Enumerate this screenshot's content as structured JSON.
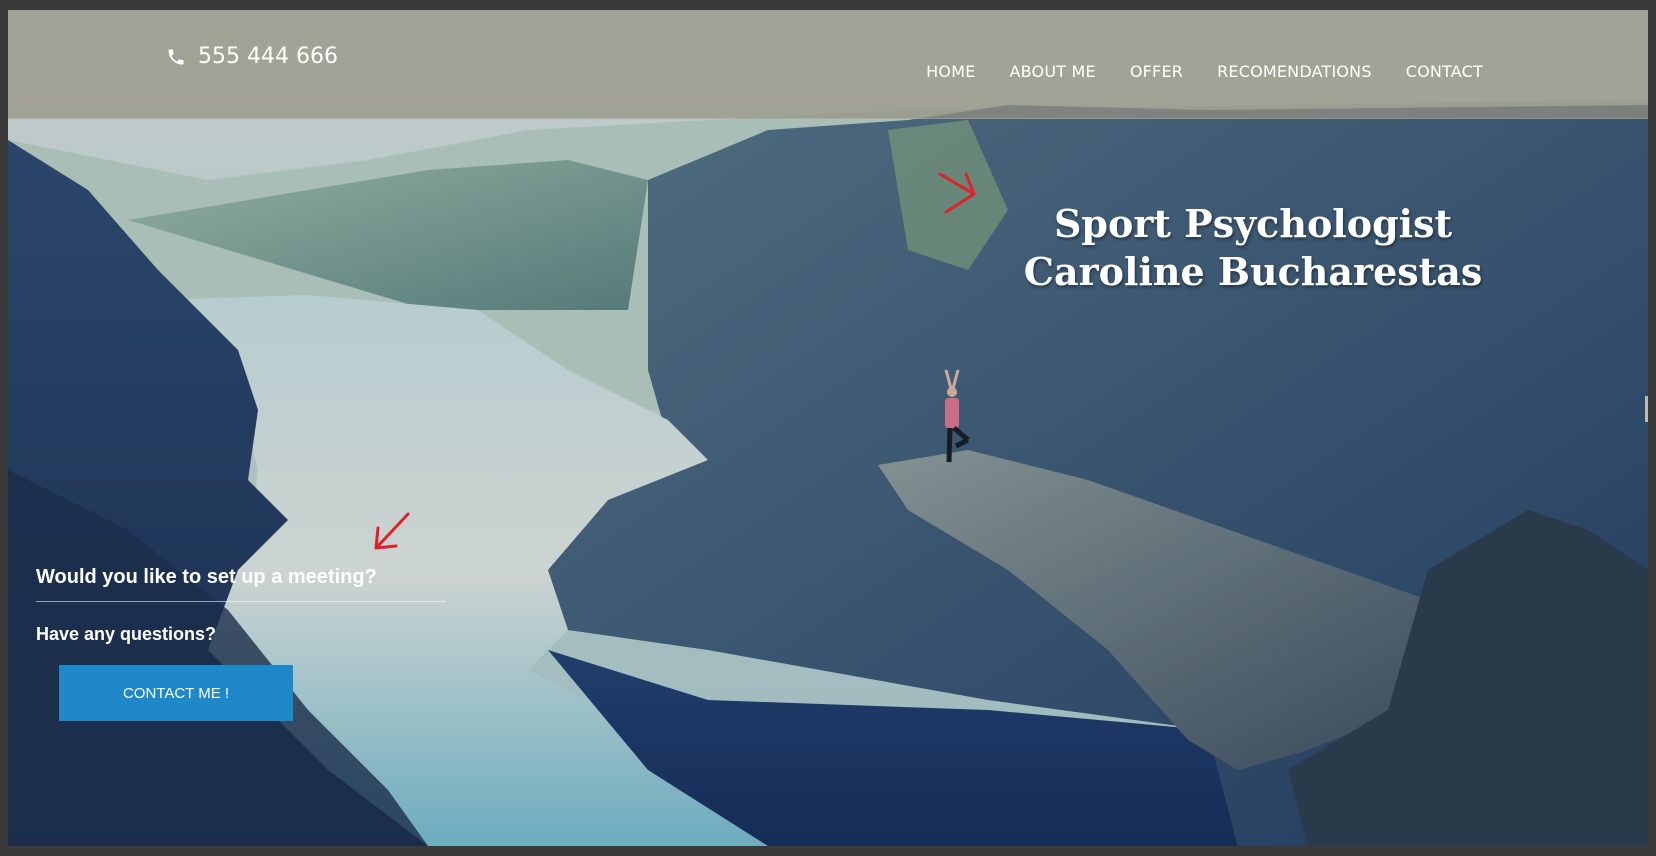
{
  "header": {
    "phone": "555 444 666",
    "nav": [
      {
        "label": "HOME"
      },
      {
        "label": "ABOUT ME"
      },
      {
        "label": "OFFER"
      },
      {
        "label": "RECOMENDATIONS"
      },
      {
        "label": "CONTACT"
      }
    ]
  },
  "hero": {
    "title_line1": "Sport Psychologist",
    "title_line2": "Caroline Bucharestas"
  },
  "cta": {
    "question": "Would you like to set up a meeting?",
    "subquestion": "Have any questions?",
    "button_label": "CONTACT ME !"
  },
  "colors": {
    "accent_button": "#1e88c8",
    "annotation_arrow": "#e0202a",
    "top_bar": "#968f82"
  },
  "icons": {
    "phone": "phone-icon",
    "annotation": "arrow-annotation-icon"
  }
}
